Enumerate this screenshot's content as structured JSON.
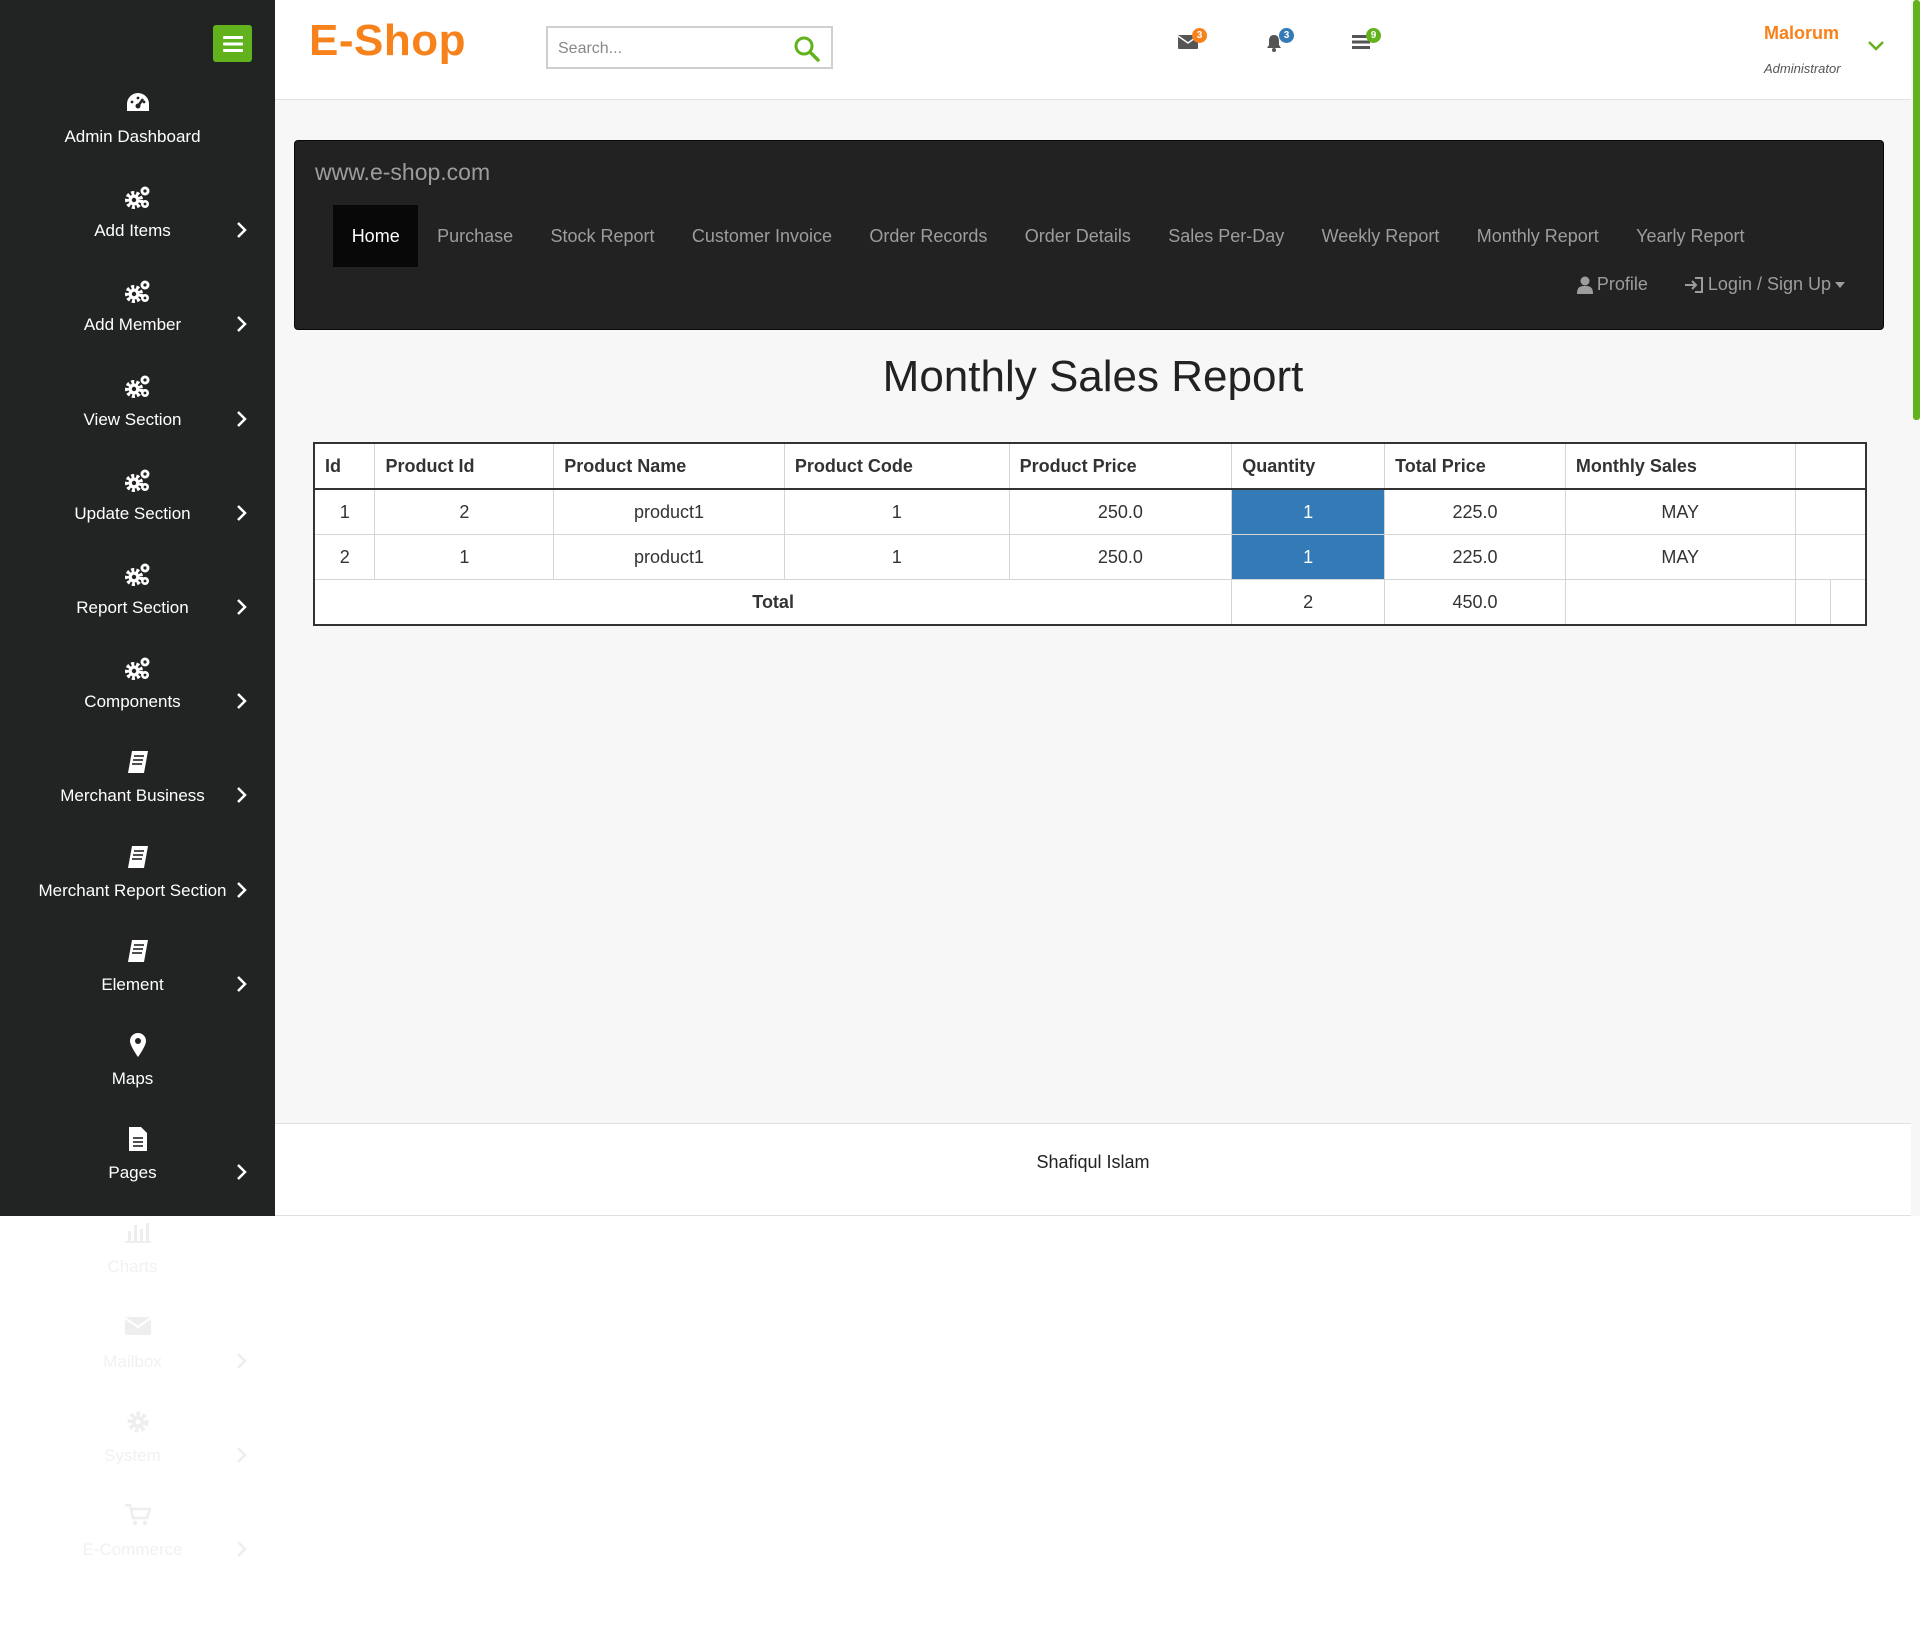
{
  "sidebar": {
    "items": [
      {
        "label": "Admin Dashboard",
        "icon": "dashboard-icon",
        "chevron": false
      },
      {
        "label": "Add Items",
        "icon": "cogs-icon",
        "chevron": true
      },
      {
        "label": "Add Member",
        "icon": "cogs-icon",
        "chevron": true
      },
      {
        "label": "View Section",
        "icon": "cogs-icon",
        "chevron": true
      },
      {
        "label": "Update Section",
        "icon": "cogs-icon",
        "chevron": true
      },
      {
        "label": "Report Section",
        "icon": "cogs-icon",
        "chevron": true
      },
      {
        "label": "Components",
        "icon": "cogs-icon",
        "chevron": true
      },
      {
        "label": "Merchant Business",
        "icon": "book-icon",
        "chevron": true
      },
      {
        "label": "Merchant Report Section",
        "icon": "book-icon",
        "chevron": true
      },
      {
        "label": "Element",
        "icon": "book-icon",
        "chevron": true
      },
      {
        "label": "Maps",
        "icon": "map-marker-icon",
        "chevron": false
      },
      {
        "label": "Pages",
        "icon": "file-icon",
        "chevron": true
      }
    ],
    "ghost_items": [
      {
        "label": "Charts",
        "icon": "bar-chart-icon",
        "chevron": false
      },
      {
        "label": "Mailbox",
        "icon": "envelope-icon",
        "chevron": true
      },
      {
        "label": "System",
        "icon": "gear-icon",
        "chevron": true
      },
      {
        "label": "E-Commerce",
        "icon": "cart-icon",
        "chevron": true
      }
    ]
  },
  "header": {
    "brand": "E-Shop",
    "search_placeholder": "Search...",
    "badges": {
      "mail": "3",
      "notifications": "3",
      "tasks": "9"
    },
    "user_name": "Malorum",
    "user_role": "Administrator"
  },
  "navbar": {
    "brand": "www.e-shop.com",
    "tabs": [
      "Home",
      "Purchase",
      "Stock Report",
      "Customer Invoice",
      "Order Records",
      "Order Details",
      "Sales Per-Day",
      "Weekly Report",
      "Monthly Report",
      "Yearly Report"
    ],
    "active_tab": "Home",
    "profile": "Profile",
    "login": "Login / Sign Up"
  },
  "report": {
    "title": "Monthly Sales Report",
    "columns": [
      "Id",
      "Product Id",
      "Product Name",
      "Product Code",
      "Product Price",
      "Quantity",
      "Total Price",
      "Monthly Sales"
    ],
    "rows": [
      [
        "1",
        "2",
        "product1",
        "1",
        "250.0",
        "1",
        "225.0",
        "MAY"
      ],
      [
        "2",
        "1",
        "product1",
        "1",
        "250.0",
        "1",
        "225.0",
        "MAY"
      ]
    ],
    "total": {
      "label": "Total",
      "quantity": "2",
      "price": "450.0"
    }
  },
  "footer": {
    "text": "Shafiqul Islam"
  },
  "colors": {
    "brand_orange": "#f7821b",
    "accent_green": "#62b21d",
    "qty_blue": "#337ab7",
    "sidebar_bg": "#222423",
    "navbar_bg": "#222222"
  }
}
